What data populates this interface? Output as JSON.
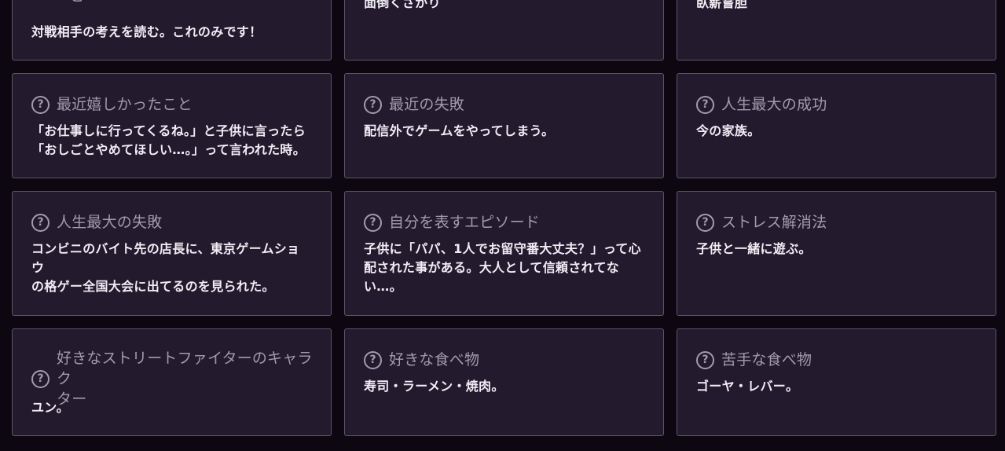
{
  "cards": [
    {
      "question": "と",
      "answer": "対戦相手の考えを読む。これのみです！"
    },
    {
      "question": "",
      "answer": "面倒くさがり"
    },
    {
      "question": "",
      "answer": "臥薪嘗胆"
    },
    {
      "question": "最近嬉しかったこと",
      "answer": "「お仕事しに行ってくるね。」と子供に言ったら\n「おしごとやめてほしい…。」って言われた時。"
    },
    {
      "question": "最近の失敗",
      "answer": "配信外でゲームをやってしまう。"
    },
    {
      "question": "人生最大の成功",
      "answer": "今の家族。"
    },
    {
      "question": "人生最大の失敗",
      "answer": "コンビニのバイト先の店長に、東京ゲームショウ\nの格ゲー全国大会に出てるのを見られた。"
    },
    {
      "question": "自分を表すエピソード",
      "answer": "子供に「パパ、1人でお留守番大丈夫？」って心\n配された事がある。大人として信頼されてな\nい…。"
    },
    {
      "question": "ストレス解消法",
      "answer": "子供と一緒に遊ぶ。"
    },
    {
      "question": "好きなストリートファイターのキャラク\nター",
      "answer": "ユン。"
    },
    {
      "question": "好きな食べ物",
      "answer": "寿司・ラーメン・焼肉。"
    },
    {
      "question": "苦手な食べ物",
      "answer": "ゴーヤ・レバー。"
    }
  ],
  "icon": {
    "name": "question-circle-icon",
    "glyph": "?"
  }
}
